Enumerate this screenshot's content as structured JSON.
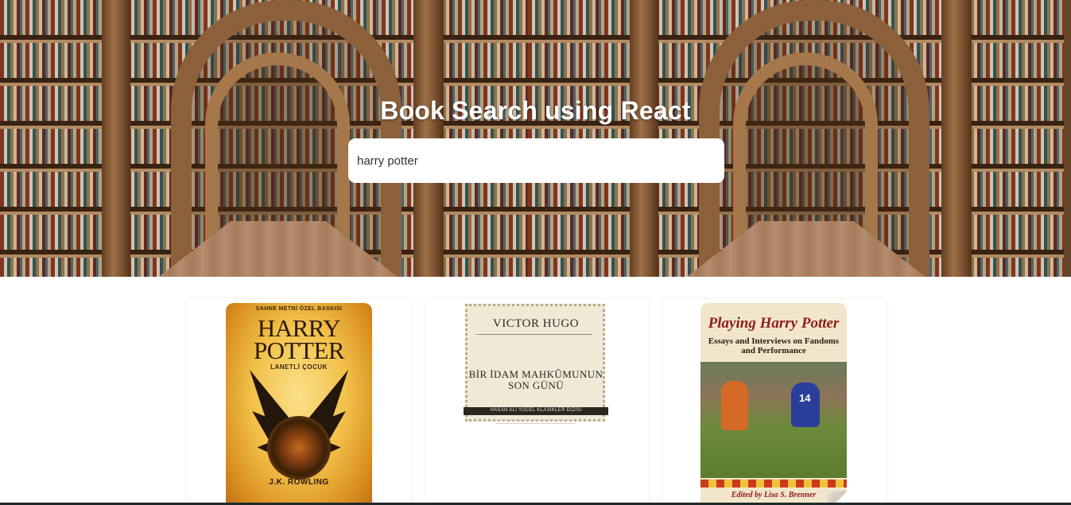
{
  "header": {
    "title": "Book Search using React"
  },
  "search": {
    "value": "harry potter"
  },
  "results": [
    {
      "cover_banner": "SAHNE METNİ ÖZEL BASKISI",
      "cover_title": "HARRY POTTER",
      "cover_subtitle": "LANETLİ ÇOCUK",
      "cover_author": "J.K. ROWLING"
    },
    {
      "cover_author": "VICTOR HUGO",
      "cover_title": "BİR İDAM MAHKÛMUNUN SON GÜNÜ",
      "cover_series": "HASAN ALİ YÜCEL KLASİKLER DİZİSİ"
    },
    {
      "cover_title": "Playing Harry Potter",
      "cover_subtitle": "Essays and Interviews on Fandoms and Performance",
      "cover_editor": "Edited by Lisa S. Brenner",
      "cover_jersey": "14"
    }
  ]
}
